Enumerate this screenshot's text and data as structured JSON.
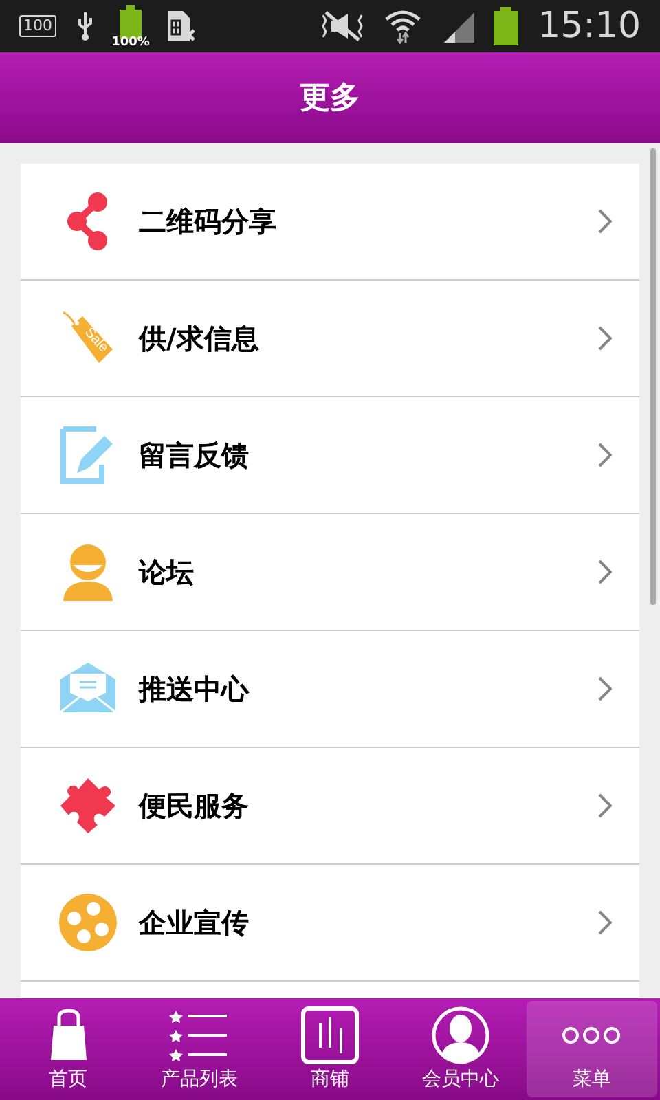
{
  "status_bar": {
    "sim_count": "100",
    "charge": "100%",
    "time": "15:10"
  },
  "header": {
    "title": "更多"
  },
  "menu": [
    {
      "label": "二维码分享"
    },
    {
      "label": "供/求信息",
      "tag_text": "Sale"
    },
    {
      "label": "留言反馈"
    },
    {
      "label": "论坛"
    },
    {
      "label": "推送中心"
    },
    {
      "label": "便民服务"
    },
    {
      "label": "企业宣传"
    }
  ],
  "tab_bar": [
    {
      "label": "首页",
      "selected": false
    },
    {
      "label": "产品列表",
      "selected": false
    },
    {
      "label": "商铺",
      "selected": false
    },
    {
      "label": "会员中心",
      "selected": false
    },
    {
      "label": "菜单",
      "selected": true
    }
  ]
}
